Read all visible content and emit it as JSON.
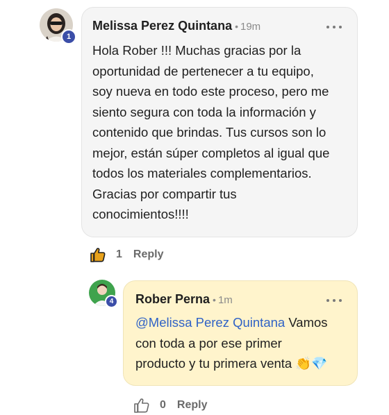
{
  "comment": {
    "author": "Melissa Perez Quintana",
    "separator": "•",
    "time": "19m",
    "level": "1",
    "text_lines": [
      "Hola Rober !!! Muchas gracias por la",
      "oportunidad de pertenecer a tu equipo,",
      "soy nueva en todo este proceso, pero me",
      "siento segura con toda la información y",
      "contenido que brindas. Tus cursos son lo",
      "mejor, están súper completos al igual que",
      "todos los materiales complementarios.",
      "Gracias por compartir tus",
      "conocimientos!!!!"
    ],
    "like_count": "1",
    "reply_label": "Reply",
    "liked": true,
    "like_icon": "thumbs-up-filled-icon",
    "more_icon": "more-horizontal-icon"
  },
  "reply": {
    "author": "Rober Perna",
    "separator": "•",
    "time": "1m",
    "level": "4",
    "mention": "@Melissa Perez Quintana",
    "line1_rest": " Vamos",
    "line2": "con toda a por ese primer",
    "line3": "producto y tu primera venta",
    "emoji": "👏💎",
    "like_count": "0",
    "reply_label": "Reply",
    "liked": false,
    "like_icon": "thumbs-up-outline-icon",
    "more_icon": "more-horizontal-icon"
  },
  "colors": {
    "badge": "#3b4ea8",
    "mention": "#2f62c6",
    "reply_bubble": "#fff4cc",
    "comment_bubble": "#f5f5f5",
    "like_active": "#e8a21c"
  }
}
